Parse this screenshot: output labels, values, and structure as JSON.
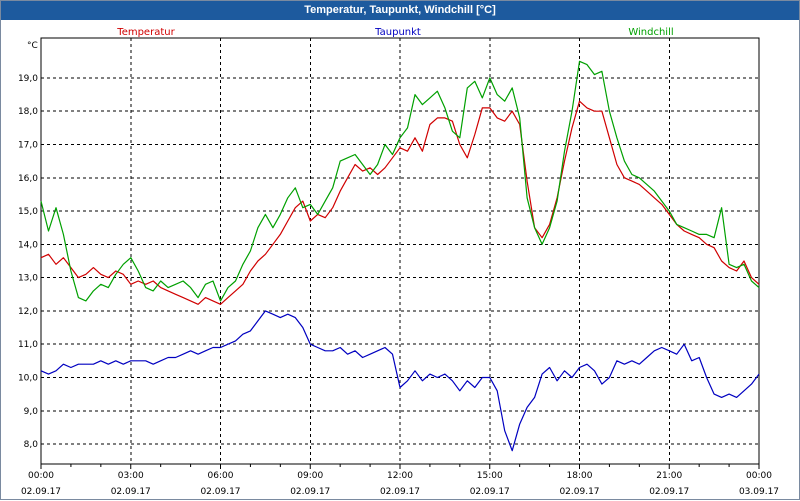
{
  "window": {
    "title": "Temperatur, Taupunkt, Windchill [°C]"
  },
  "chart_data": {
    "type": "line",
    "title": "Temperatur, Taupunkt, Windchill [°C]",
    "ylabel": "°C",
    "xlabel": "",
    "ylim": [
      7.4,
      20.2
    ],
    "xlim": [
      0,
      24
    ],
    "y_ticks": [
      "8,0",
      "9,0",
      "10,0",
      "11,0",
      "12,0",
      "13,0",
      "14,0",
      "15,0",
      "16,0",
      "17,0",
      "18,0",
      "19,0"
    ],
    "y_tick_values": [
      8,
      9,
      10,
      11,
      12,
      13,
      14,
      15,
      16,
      17,
      18,
      19
    ],
    "x_ticks": [
      {
        "time": "00:00",
        "date": "02.09.17",
        "hour": 0
      },
      {
        "time": "03:00",
        "date": "02.09.17",
        "hour": 3
      },
      {
        "time": "06:00",
        "date": "02.09.17",
        "hour": 6
      },
      {
        "time": "09:00",
        "date": "02.09.17",
        "hour": 9
      },
      {
        "time": "12:00",
        "date": "02.09.17",
        "hour": 12
      },
      {
        "time": "15:00",
        "date": "02.09.17",
        "hour": 15
      },
      {
        "time": "18:00",
        "date": "02.09.17",
        "hour": 18
      },
      {
        "time": "21:00",
        "date": "02.09.17",
        "hour": 21
      },
      {
        "time": "00:00",
        "date": "03.09.17",
        "hour": 24
      }
    ],
    "grid": true,
    "legend": "top",
    "series": [
      {
        "name": "Temperatur",
        "color": "#d00000",
        "points": [
          [
            0,
            13.6
          ],
          [
            0.25,
            13.7
          ],
          [
            0.5,
            13.4
          ],
          [
            0.75,
            13.6
          ],
          [
            1.0,
            13.3
          ],
          [
            1.25,
            13.0
          ],
          [
            1.5,
            13.1
          ],
          [
            1.75,
            13.3
          ],
          [
            2.0,
            13.1
          ],
          [
            2.25,
            13.0
          ],
          [
            2.5,
            13.2
          ],
          [
            2.75,
            13.1
          ],
          [
            3.0,
            12.8
          ],
          [
            3.25,
            12.9
          ],
          [
            3.5,
            12.8
          ],
          [
            3.75,
            12.9
          ],
          [
            4.0,
            12.7
          ],
          [
            4.25,
            12.6
          ],
          [
            4.5,
            12.5
          ],
          [
            4.75,
            12.4
          ],
          [
            5.0,
            12.3
          ],
          [
            5.25,
            12.2
          ],
          [
            5.5,
            12.4
          ],
          [
            5.75,
            12.3
          ],
          [
            6.0,
            12.2
          ],
          [
            6.25,
            12.4
          ],
          [
            6.5,
            12.6
          ],
          [
            6.75,
            12.8
          ],
          [
            7.0,
            13.2
          ],
          [
            7.25,
            13.5
          ],
          [
            7.5,
            13.7
          ],
          [
            7.75,
            14.0
          ],
          [
            8.0,
            14.3
          ],
          [
            8.25,
            14.7
          ],
          [
            8.5,
            15.1
          ],
          [
            8.75,
            15.3
          ],
          [
            9.0,
            14.7
          ],
          [
            9.25,
            14.9
          ],
          [
            9.5,
            14.8
          ],
          [
            9.75,
            15.1
          ],
          [
            10.0,
            15.6
          ],
          [
            10.25,
            16.0
          ],
          [
            10.5,
            16.4
          ],
          [
            10.75,
            16.2
          ],
          [
            11.0,
            16.3
          ],
          [
            11.25,
            16.1
          ],
          [
            11.5,
            16.3
          ],
          [
            11.75,
            16.6
          ],
          [
            12.0,
            16.9
          ],
          [
            12.25,
            16.8
          ],
          [
            12.5,
            17.2
          ],
          [
            12.75,
            16.8
          ],
          [
            13.0,
            17.6
          ],
          [
            13.25,
            17.8
          ],
          [
            13.5,
            17.8
          ],
          [
            13.75,
            17.7
          ],
          [
            14.0,
            17.0
          ],
          [
            14.25,
            16.6
          ],
          [
            14.5,
            17.3
          ],
          [
            14.75,
            18.1
          ],
          [
            15.0,
            18.1
          ],
          [
            15.25,
            17.8
          ],
          [
            15.5,
            17.7
          ],
          [
            15.75,
            18.0
          ],
          [
            16.0,
            17.6
          ],
          [
            16.25,
            15.9
          ],
          [
            16.5,
            14.5
          ],
          [
            16.75,
            14.2
          ],
          [
            17.0,
            14.6
          ],
          [
            17.25,
            15.4
          ],
          [
            17.5,
            16.5
          ],
          [
            17.75,
            17.5
          ],
          [
            18.0,
            18.3
          ],
          [
            18.25,
            18.1
          ],
          [
            18.5,
            18.0
          ],
          [
            18.75,
            18.0
          ],
          [
            19.0,
            17.2
          ],
          [
            19.25,
            16.4
          ],
          [
            19.5,
            16.0
          ],
          [
            19.75,
            15.9
          ],
          [
            20.0,
            15.8
          ],
          [
            20.25,
            15.6
          ],
          [
            20.5,
            15.4
          ],
          [
            20.75,
            15.2
          ],
          [
            21.0,
            14.9
          ],
          [
            21.25,
            14.6
          ],
          [
            21.5,
            14.4
          ],
          [
            21.75,
            14.3
          ],
          [
            22.0,
            14.2
          ],
          [
            22.25,
            14.0
          ],
          [
            22.5,
            13.9
          ],
          [
            22.75,
            13.5
          ],
          [
            23.0,
            13.3
          ],
          [
            23.25,
            13.2
          ],
          [
            23.5,
            13.5
          ],
          [
            23.75,
            13.0
          ],
          [
            24.0,
            12.8
          ]
        ]
      },
      {
        "name": "Taupunkt",
        "color": "#0000c0",
        "points": [
          [
            0,
            10.2
          ],
          [
            0.25,
            10.1
          ],
          [
            0.5,
            10.2
          ],
          [
            0.75,
            10.4
          ],
          [
            1.0,
            10.3
          ],
          [
            1.25,
            10.4
          ],
          [
            1.5,
            10.4
          ],
          [
            1.75,
            10.4
          ],
          [
            2.0,
            10.5
          ],
          [
            2.25,
            10.4
          ],
          [
            2.5,
            10.5
          ],
          [
            2.75,
            10.4
          ],
          [
            3.0,
            10.5
          ],
          [
            3.25,
            10.5
          ],
          [
            3.5,
            10.5
          ],
          [
            3.75,
            10.4
          ],
          [
            4.0,
            10.5
          ],
          [
            4.25,
            10.6
          ],
          [
            4.5,
            10.6
          ],
          [
            4.75,
            10.7
          ],
          [
            5.0,
            10.8
          ],
          [
            5.25,
            10.7
          ],
          [
            5.5,
            10.8
          ],
          [
            5.75,
            10.9
          ],
          [
            6.0,
            10.9
          ],
          [
            6.25,
            11.0
          ],
          [
            6.5,
            11.1
          ],
          [
            6.75,
            11.3
          ],
          [
            7.0,
            11.4
          ],
          [
            7.25,
            11.7
          ],
          [
            7.5,
            12.0
          ],
          [
            7.75,
            11.9
          ],
          [
            8.0,
            11.8
          ],
          [
            8.25,
            11.9
          ],
          [
            8.5,
            11.8
          ],
          [
            8.75,
            11.5
          ],
          [
            9.0,
            11.0
          ],
          [
            9.25,
            10.9
          ],
          [
            9.5,
            10.8
          ],
          [
            9.75,
            10.8
          ],
          [
            10.0,
            10.9
          ],
          [
            10.25,
            10.7
          ],
          [
            10.5,
            10.8
          ],
          [
            10.75,
            10.6
          ],
          [
            11.0,
            10.7
          ],
          [
            11.25,
            10.8
          ],
          [
            11.5,
            10.9
          ],
          [
            11.75,
            10.7
          ],
          [
            12.0,
            9.7
          ],
          [
            12.25,
            9.9
          ],
          [
            12.5,
            10.2
          ],
          [
            12.75,
            9.9
          ],
          [
            13.0,
            10.1
          ],
          [
            13.25,
            10.0
          ],
          [
            13.5,
            10.1
          ],
          [
            13.75,
            9.9
          ],
          [
            14.0,
            9.6
          ],
          [
            14.25,
            9.9
          ],
          [
            14.5,
            9.7
          ],
          [
            14.75,
            10.0
          ],
          [
            15.0,
            10.0
          ],
          [
            15.25,
            9.6
          ],
          [
            15.5,
            8.4
          ],
          [
            15.75,
            7.8
          ],
          [
            16.0,
            8.6
          ],
          [
            16.25,
            9.1
          ],
          [
            16.5,
            9.4
          ],
          [
            16.75,
            10.1
          ],
          [
            17.0,
            10.3
          ],
          [
            17.25,
            9.9
          ],
          [
            17.5,
            10.2
          ],
          [
            17.75,
            10.0
          ],
          [
            18.0,
            10.3
          ],
          [
            18.25,
            10.4
          ],
          [
            18.5,
            10.2
          ],
          [
            18.75,
            9.8
          ],
          [
            19.0,
            10.0
          ],
          [
            19.25,
            10.5
          ],
          [
            19.5,
            10.4
          ],
          [
            19.75,
            10.5
          ],
          [
            20.0,
            10.4
          ],
          [
            20.25,
            10.6
          ],
          [
            20.5,
            10.8
          ],
          [
            20.75,
            10.9
          ],
          [
            21.0,
            10.8
          ],
          [
            21.25,
            10.7
          ],
          [
            21.5,
            11.0
          ],
          [
            21.75,
            10.5
          ],
          [
            22.0,
            10.6
          ],
          [
            22.25,
            10.0
          ],
          [
            22.5,
            9.5
          ],
          [
            22.75,
            9.4
          ],
          [
            23.0,
            9.5
          ],
          [
            23.25,
            9.4
          ],
          [
            23.5,
            9.6
          ],
          [
            23.75,
            9.8
          ],
          [
            24.0,
            10.1
          ]
        ]
      },
      {
        "name": "Windchill",
        "color": "#00a000",
        "points": [
          [
            0,
            15.3
          ],
          [
            0.25,
            14.4
          ],
          [
            0.5,
            15.1
          ],
          [
            0.75,
            14.3
          ],
          [
            1.0,
            13.2
          ],
          [
            1.25,
            12.4
          ],
          [
            1.5,
            12.3
          ],
          [
            1.75,
            12.6
          ],
          [
            2.0,
            12.8
          ],
          [
            2.25,
            12.7
          ],
          [
            2.5,
            13.1
          ],
          [
            2.75,
            13.4
          ],
          [
            3.0,
            13.6
          ],
          [
            3.25,
            13.2
          ],
          [
            3.5,
            12.7
          ],
          [
            3.75,
            12.6
          ],
          [
            4.0,
            12.9
          ],
          [
            4.25,
            12.7
          ],
          [
            4.5,
            12.8
          ],
          [
            4.75,
            12.9
          ],
          [
            5.0,
            12.7
          ],
          [
            5.25,
            12.4
          ],
          [
            5.5,
            12.8
          ],
          [
            5.75,
            12.9
          ],
          [
            6.0,
            12.3
          ],
          [
            6.25,
            12.7
          ],
          [
            6.5,
            12.9
          ],
          [
            6.75,
            13.4
          ],
          [
            7.0,
            13.8
          ],
          [
            7.25,
            14.5
          ],
          [
            7.5,
            14.9
          ],
          [
            7.75,
            14.5
          ],
          [
            8.0,
            14.9
          ],
          [
            8.25,
            15.4
          ],
          [
            8.5,
            15.7
          ],
          [
            8.75,
            15.1
          ],
          [
            9.0,
            15.2
          ],
          [
            9.25,
            14.9
          ],
          [
            9.5,
            15.3
          ],
          [
            9.75,
            15.7
          ],
          [
            10.0,
            16.5
          ],
          [
            10.25,
            16.6
          ],
          [
            10.5,
            16.7
          ],
          [
            10.75,
            16.4
          ],
          [
            11.0,
            16.1
          ],
          [
            11.25,
            16.4
          ],
          [
            11.5,
            17.0
          ],
          [
            11.75,
            16.7
          ],
          [
            12.0,
            17.2
          ],
          [
            12.25,
            17.5
          ],
          [
            12.5,
            18.5
          ],
          [
            12.75,
            18.2
          ],
          [
            13.0,
            18.4
          ],
          [
            13.25,
            18.6
          ],
          [
            13.5,
            18.1
          ],
          [
            13.75,
            17.4
          ],
          [
            14.0,
            17.2
          ],
          [
            14.25,
            18.7
          ],
          [
            14.5,
            18.9
          ],
          [
            14.75,
            18.4
          ],
          [
            15.0,
            19.0
          ],
          [
            15.25,
            18.5
          ],
          [
            15.5,
            18.3
          ],
          [
            15.75,
            18.7
          ],
          [
            16.0,
            17.8
          ],
          [
            16.25,
            15.4
          ],
          [
            16.5,
            14.5
          ],
          [
            16.75,
            14.0
          ],
          [
            17.0,
            14.5
          ],
          [
            17.25,
            15.3
          ],
          [
            17.5,
            16.8
          ],
          [
            17.75,
            18.0
          ],
          [
            18.0,
            19.5
          ],
          [
            18.25,
            19.4
          ],
          [
            18.5,
            19.1
          ],
          [
            18.75,
            19.2
          ],
          [
            19.0,
            18.0
          ],
          [
            19.25,
            17.2
          ],
          [
            19.5,
            16.5
          ],
          [
            19.75,
            16.1
          ],
          [
            20.0,
            16.0
          ],
          [
            20.25,
            15.8
          ],
          [
            20.5,
            15.6
          ],
          [
            20.75,
            15.3
          ],
          [
            21.0,
            15.0
          ],
          [
            21.25,
            14.6
          ],
          [
            21.5,
            14.5
          ],
          [
            21.75,
            14.4
          ],
          [
            22.0,
            14.3
          ],
          [
            22.25,
            14.3
          ],
          [
            22.5,
            14.2
          ],
          [
            22.75,
            15.1
          ],
          [
            23.0,
            13.4
          ],
          [
            23.25,
            13.3
          ],
          [
            23.5,
            13.4
          ],
          [
            23.75,
            12.9
          ],
          [
            24.0,
            12.7
          ]
        ]
      }
    ]
  }
}
